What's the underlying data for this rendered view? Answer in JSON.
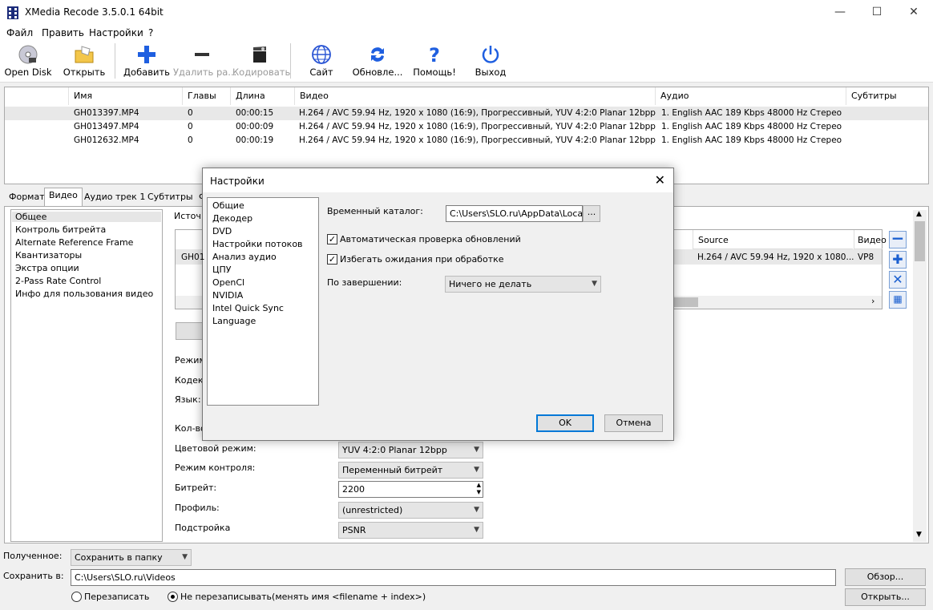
{
  "window": {
    "title": "XMedia Recode 3.5.0.1 64bit",
    "minimize": "—",
    "maximize": "☐",
    "close": "✕"
  },
  "menu": [
    "Файл",
    "Править",
    "Настройки",
    "?"
  ],
  "toolbar": {
    "open_disk": "Open Disk",
    "open": "Открыть",
    "add": "Добавить",
    "remove": "Удалить ра...",
    "encode": "Кодировать",
    "site": "Сайт",
    "update": "Обновле...",
    "help": "Помощь!",
    "exit": "Выход"
  },
  "filelist": {
    "headers": [
      "Имя",
      "Главы",
      "Длина",
      "Видео",
      "Аудио",
      "Субтитры"
    ],
    "rows": [
      {
        "name": "GH013397.MP4",
        "chapters": "0",
        "length": "00:00:15",
        "video": "H.264 / AVC  59.94 Hz, 1920 x 1080 (16:9), Прогрессивный, YUV 4:2:0 Planar 12bpp",
        "audio": "1. English AAC  189 Kbps 48000 Hz Стерео"
      },
      {
        "name": "GH013497.MP4",
        "chapters": "0",
        "length": "00:00:09",
        "video": "H.264 / AVC  59.94 Hz, 1920 x 1080 (16:9), Прогрессивный, YUV 4:2:0 Planar 12bpp",
        "audio": "1. English AAC  189 Kbps 48000 Hz Стерео"
      },
      {
        "name": "GH012632.MP4",
        "chapters": "0",
        "length": "00:00:19",
        "video": "H.264 / AVC  59.94 Hz, 1920 x 1080 (16:9), Прогрессивный, YUV 4:2:0 Planar 12bpp",
        "audio": "1. English AAC  189 Kbps 48000 Hz Стерео"
      }
    ]
  },
  "tabs": [
    "Формат",
    "Видео",
    "Аудио трек 1",
    "Субтитры",
    "Ф"
  ],
  "left_panel": [
    "Общее",
    "Контроль битрейта",
    "Alternate Reference Frame",
    "Квантизаторы",
    "Экстра опции",
    "2-Pass Rate Control",
    "Инфо для пользования видео"
  ],
  "main": {
    "source_label": "Источ",
    "stream_row_prefix": "GH01",
    "stream_headers": {
      "source": "Source",
      "video": "Видео"
    },
    "stream_row": {
      "source": "H.264 / AVC  59.94 Hz, 1920 x 1080...",
      "video": "VP8"
    },
    "mode_label": "Режим:",
    "codec_label": "Кодек:",
    "lang_label": "Язык:",
    "count_label": "Кол-во",
    "color_mode_label": "Цветовой режим:",
    "color_mode_value": "YUV 4:2:0 Planar 12bpp",
    "control_mode_label": "Режим контроля:",
    "control_mode_value": "Переменный битрейт",
    "bitrate_label": "Битрейт:",
    "bitrate_value": "2200",
    "profile_label": "Профиль:",
    "profile_value": "(unrestricted)",
    "tune_label": "Подстройка",
    "tune_value": "PSNR"
  },
  "bottom": {
    "output_label": "Полученное:",
    "output_value": "Сохранить в папку",
    "save_label": "Сохранить в:",
    "save_path": "C:\\Users\\SLO.ru\\Videos",
    "browse": "Обзор...",
    "open": "Открыть...",
    "overwrite": "Перезаписать",
    "no_overwrite": "Не перезаписывать(менять имя <filename + index>)"
  },
  "dialog": {
    "title": "Настройки",
    "categories": [
      "Общие",
      "Декодер",
      "DVD",
      "Настройки потоков",
      "Анализ аудио",
      "ЦПУ",
      "OpenCl",
      "NVIDIA",
      "Intel Quick Sync",
      "Language"
    ],
    "temp_dir_label": "Временный каталог:",
    "temp_dir_value": "C:\\Users\\SLO.ru\\AppData\\Local\\T",
    "browse": "...",
    "auto_update": "Автоматическая проверка обновлений",
    "avoid_wait": "Избегать ожидания при обработке",
    "on_finish_label": "По завершении:",
    "on_finish_value": "Ничего не делать",
    "ok": "OK",
    "cancel": "Отмена"
  }
}
